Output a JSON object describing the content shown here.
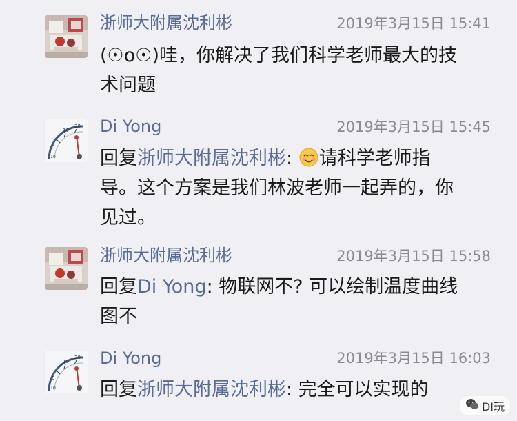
{
  "comments": [
    {
      "author": "浙师大附属沈利彬",
      "time": "2019年3月15日 15:41",
      "text_line1": "(☉o☉)哇，你解决了我们科学老师最大的技",
      "text_line2": "术问题"
    },
    {
      "author": "Di Yong",
      "time": "2019年3月15日 15:45",
      "reply_prefix": "回复",
      "reply_to": "浙师大附属沈利彬",
      "colon": ": ",
      "emoji": "smiling-face-icon",
      "text_after_emoji": "请科学老师指",
      "text_line2": "导。这个方案是我们林波老师一起弄的，你",
      "text_line3": "见过。"
    },
    {
      "author": "浙师大附属沈利彬",
      "time": "2019年3月15日 15:58",
      "reply_prefix": "回复",
      "reply_to": "Di Yong",
      "colon": ": ",
      "text_line1_rest": "物联网不? 可以绘制温度曲线",
      "text_line2": "图不"
    },
    {
      "author": "Di Yong",
      "time": "2019年3月15日 16:03",
      "reply_prefix": "回复",
      "reply_to": "浙师大附属沈利彬",
      "colon": ": ",
      "text_line1_rest": "完全可以实现的"
    }
  ],
  "watermark": {
    "label": "DI玩",
    "icon": "wechat-icon"
  },
  "colors": {
    "background": "#efeff4",
    "name": "#576b95",
    "time": "#8a8a8f",
    "text": "#1a1a1a"
  }
}
